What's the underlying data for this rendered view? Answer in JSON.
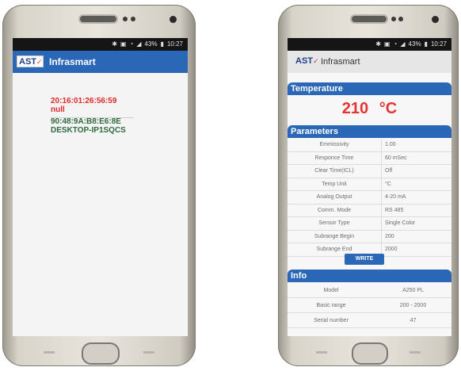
{
  "left_phone": {
    "status": {
      "time": "10:27",
      "battery": "43%",
      "icons": [
        "bluetooth-icon",
        "battery-saver-icon",
        "wifi-icon",
        "signal-icon",
        "battery-icon"
      ]
    },
    "app_bar": {
      "logo": "AST",
      "title": "Infrasmart"
    },
    "devices": [
      {
        "address": "20:16:01:26:56:59",
        "name": "null",
        "color": "#e02a2a"
      },
      {
        "address": "90:48:9A:B8:E6:8E",
        "name": "DESKTOP-IP1SQCS",
        "color": "#2d6a3e"
      }
    ]
  },
  "right_phone": {
    "status": {
      "time": "10:27",
      "battery": "43%"
    },
    "app_bar": {
      "logo": "AST",
      "title": "Infrasmart"
    },
    "temperature": {
      "title": "Temperature",
      "value": "210",
      "unit": "°C"
    },
    "parameters": {
      "title": "Parameters",
      "rows": [
        {
          "label": "Emmissivity",
          "value": "1.00"
        },
        {
          "label": "Responce Time",
          "value": "60 mSec"
        },
        {
          "label": "Clear Time(ICL)",
          "value": "Off"
        },
        {
          "label": "Temp Unit",
          "value": "°C"
        },
        {
          "label": "Analog Output",
          "value": "4-20 mA"
        },
        {
          "label": "Comm. Mode",
          "value": "RS 485"
        },
        {
          "label": "Sensor Type",
          "value": "Single Color"
        },
        {
          "label": "Subrange Begin",
          "value": "200"
        },
        {
          "label": "Subrange End",
          "value": "2000"
        }
      ],
      "write_label": "WRITE"
    },
    "info": {
      "title": "Info",
      "rows": [
        {
          "label": "Model",
          "value": "A250 PL"
        },
        {
          "label": "Basic range",
          "value": "200 - 2000"
        },
        {
          "label": "Serial number",
          "value": "47"
        }
      ]
    }
  },
  "colors": {
    "accent": "#2a67b6",
    "temperature": "#e63333"
  }
}
